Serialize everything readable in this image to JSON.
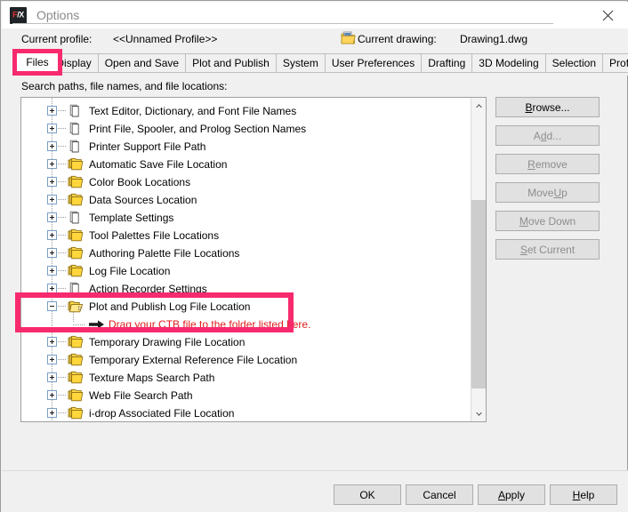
{
  "window": {
    "title": "Options",
    "app_icon": "fx-logo-icon",
    "close_icon": "close-icon"
  },
  "header": {
    "profile_label": "Current profile:",
    "profile_value": "<<Unnamed Profile>>",
    "drawing_icon": "drawing-file-icon",
    "drawing_label": "Current drawing:",
    "drawing_value": "Drawing1.dwg"
  },
  "tabs": {
    "active": "Files",
    "items": [
      {
        "label": "Files",
        "active": true
      },
      {
        "label": "Display",
        "active": false
      },
      {
        "label": "Open and Save",
        "active": false
      },
      {
        "label": "Plot and Publish",
        "active": false
      },
      {
        "label": "System",
        "active": false
      },
      {
        "label": "User Preferences",
        "active": false
      },
      {
        "label": "Drafting",
        "active": false
      },
      {
        "label": "3D Modeling",
        "active": false
      },
      {
        "label": "Selection",
        "active": false
      },
      {
        "label": "Profiles",
        "active": false
      }
    ]
  },
  "main": {
    "panel_label": "Search paths, file names, and file locations:",
    "tree": [
      {
        "label": "Text Editor, Dictionary, and Font File Names",
        "icon": "page-icon",
        "state": "collapsed"
      },
      {
        "label": "Print File, Spooler, and Prolog Section Names",
        "icon": "page-icon",
        "state": "collapsed"
      },
      {
        "label": "Printer Support File Path",
        "icon": "page-icon",
        "state": "collapsed"
      },
      {
        "label": "Automatic Save File Location",
        "icon": "folder-stack-icon",
        "state": "collapsed"
      },
      {
        "label": "Color Book Locations",
        "icon": "folder-stack-icon",
        "state": "collapsed"
      },
      {
        "label": "Data Sources Location",
        "icon": "folder-stack-icon",
        "state": "collapsed"
      },
      {
        "label": "Template Settings",
        "icon": "page-icon",
        "state": "collapsed"
      },
      {
        "label": "Tool Palettes File Locations",
        "icon": "folder-stack-icon",
        "state": "collapsed"
      },
      {
        "label": "Authoring Palette File Locations",
        "icon": "folder-stack-icon",
        "state": "collapsed"
      },
      {
        "label": "Log File Location",
        "icon": "folder-stack-icon",
        "state": "collapsed"
      },
      {
        "label": "Action Recorder Settings",
        "icon": "page-icon",
        "state": "collapsed"
      },
      {
        "label": "Plot and Publish Log File Location",
        "icon": "folder-stack-icon",
        "state": "expanded",
        "highlighted": true
      },
      {
        "label": "Temporary Drawing File Location",
        "icon": "folder-stack-icon",
        "state": "collapsed"
      },
      {
        "label": "Temporary External Reference File Location",
        "icon": "folder-stack-icon",
        "state": "collapsed"
      },
      {
        "label": "Texture Maps Search Path",
        "icon": "folder-stack-icon",
        "state": "collapsed"
      },
      {
        "label": "Web File Search Path",
        "icon": "folder-stack-icon",
        "state": "collapsed"
      },
      {
        "label": "i-drop Associated File Location",
        "icon": "folder-stack-icon",
        "state": "collapsed"
      }
    ],
    "annotation": {
      "text": "Drag your CTB file to the folder listed here.",
      "icon": "right-arrow-icon",
      "color": "#e01b1b",
      "parent_row_index": 11
    },
    "scrollbar": {
      "up_icon": "chevron-up-icon",
      "down_icon": "chevron-down-icon"
    }
  },
  "side_buttons": [
    {
      "label": "Browse...",
      "mnemonic": "B",
      "disabled": false
    },
    {
      "label": "Add...",
      "mnemonic": "d",
      "disabled": true
    },
    {
      "label": "Remove",
      "mnemonic": "R",
      "disabled": true
    },
    {
      "label": "Move Up",
      "mnemonic": "U",
      "disabled": true
    },
    {
      "label": "Move Down",
      "mnemonic": "M",
      "disabled": true
    },
    {
      "label": "Set Current",
      "mnemonic": "S",
      "disabled": true
    }
  ],
  "bottom_buttons": {
    "ok": "OK",
    "cancel": "Cancel",
    "apply": "Apply",
    "apply_mnemonic": "A",
    "help": "Help",
    "help_mnemonic": "H"
  },
  "colors": {
    "highlight_pink": "#f82a6e",
    "annotation_red": "#e01b1b",
    "dialog_bg": "#f0f0f0",
    "button_face": "#e1e1e1"
  }
}
